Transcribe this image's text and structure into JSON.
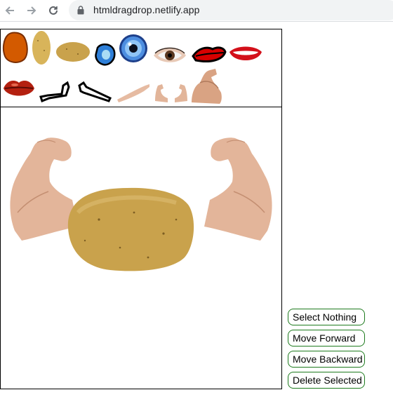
{
  "browser": {
    "url": "htmldragdrop.netlify.app",
    "icons": [
      "back-arrow-icon",
      "forward-arrow-icon",
      "reload-icon",
      "lock-icon"
    ]
  },
  "palette": {
    "items": [
      "orange-potato",
      "potato",
      "flat-potato",
      "blue-ear",
      "blue-eye",
      "brown-eye",
      "red-lips-outline",
      "smiling-mouth",
      "red-lips",
      "bent-arm-outline",
      "arm-outline",
      "pointing-arm",
      "flex-arms-pair",
      "flexed-bicep"
    ]
  },
  "canvas": {
    "composition": [
      "left-flexed-arm",
      "right-flexed-arm",
      "potato-body"
    ]
  },
  "buttons": {
    "select_nothing": "Select Nothing",
    "move_forward": "Move Forward",
    "move_backward": "Move Backward",
    "delete_selected": "Delete Selected"
  },
  "colors": {
    "button_border": "#1e7b1e",
    "potato": "#c8a24a",
    "skin": "#e2b59a"
  }
}
